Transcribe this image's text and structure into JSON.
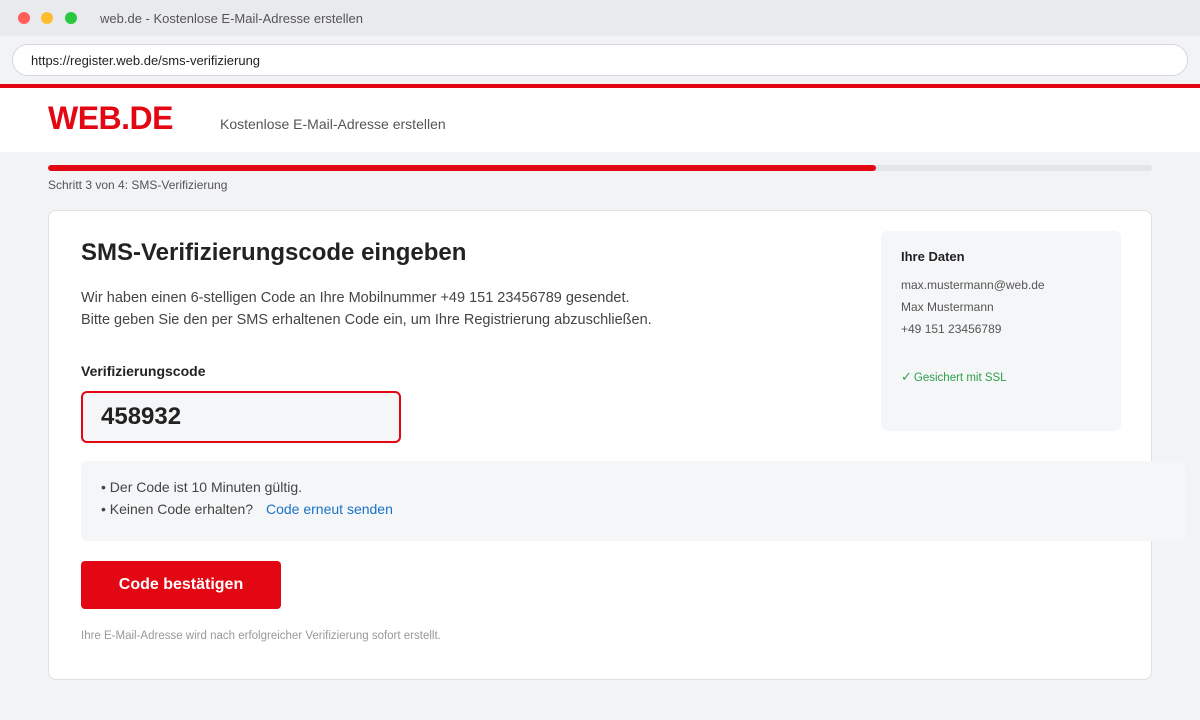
{
  "window": {
    "title": "web.de - Kostenlose E-Mail-Adresse erstellen",
    "url": "https://register.web.de/sms-verifizierung"
  },
  "header": {
    "logo": "WEB.DE",
    "tagline": "Kostenlose E-Mail-Adresse erstellen"
  },
  "progress": {
    "step_label": "Schritt 3 von 4: SMS-Verifizierung",
    "fraction": 0.75
  },
  "main": {
    "title": "SMS-Verifizierungscode eingeben",
    "desc_line1": "Wir haben einen 6-stelligen Code an Ihre Mobilnummer +49 151 23456789 gesendet.",
    "desc_line2": "Bitte geben Sie den per SMS erhaltenen Code ein, um Ihre Registrierung abzuschließen.",
    "field_label": "Verifizierungscode",
    "code_value": "458932",
    "info_line1": "• Der Code ist 10 Minuten gültig.",
    "info_line2": "• Keinen Code erhalten?",
    "resend_link": "Code erneut senden",
    "confirm_button": "Code bestätigen",
    "footnote": "Ihre E-Mail-Adresse wird nach erfolgreicher Verifizierung sofort erstellt."
  },
  "side": {
    "title": "Ihre Daten",
    "email": "max.mustermann@web.de",
    "name": "Max Mustermann",
    "phone": "+49 151 23456789",
    "ssl_text": "Gesichert mit SSL",
    "ssl_icon": "check-icon"
  },
  "colors": {
    "brand_red": "#e30613",
    "link_blue": "#1a73c7",
    "success_green": "#2e9e4a"
  }
}
